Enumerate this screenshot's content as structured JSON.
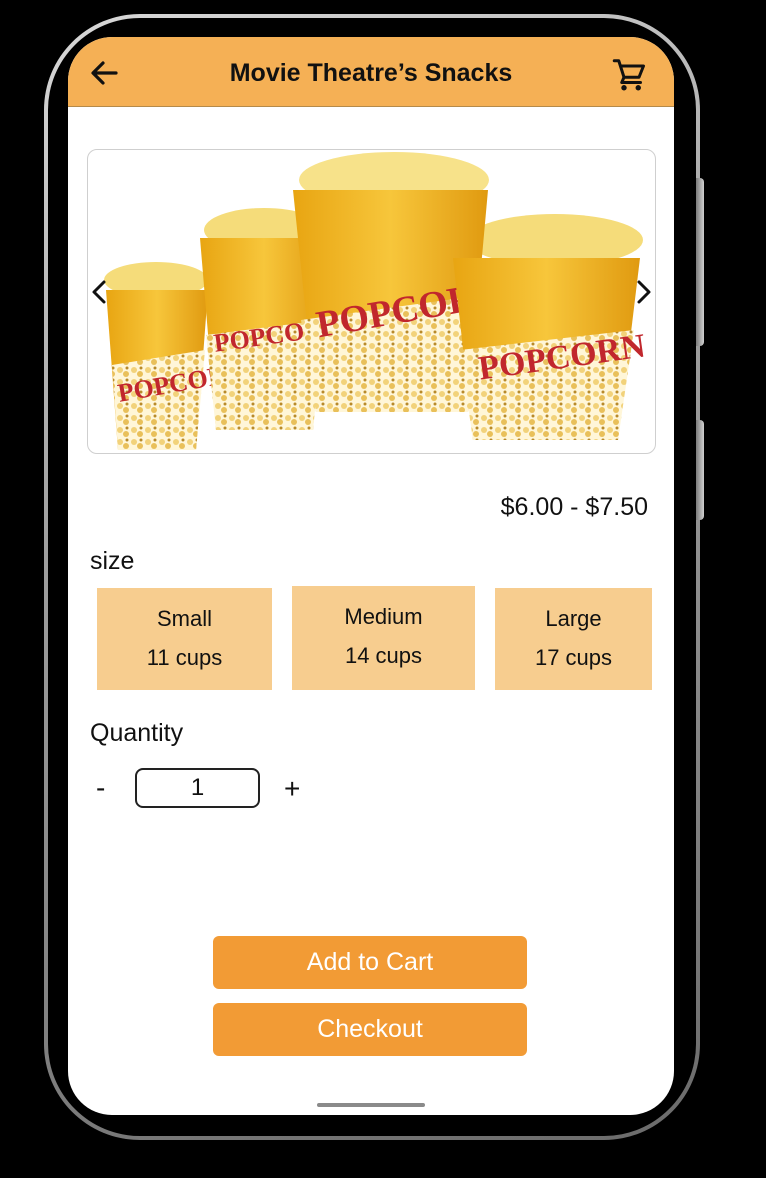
{
  "header": {
    "title": "Movie Theatre’s Snacks",
    "back_icon": "arrow-left-icon",
    "cart_icon": "shopping-cart-icon",
    "background": "#f5b055"
  },
  "product": {
    "image_label": "POPCORN",
    "price_range": "$6.00 - $7.50"
  },
  "size": {
    "label": "size",
    "options": [
      {
        "name": "Small",
        "cups": "11 cups"
      },
      {
        "name": "Medium",
        "cups": "14 cups"
      },
      {
        "name": "Large",
        "cups": "17 cups"
      }
    ],
    "option_color": "#f7cd8f"
  },
  "quantity": {
    "label": "Quantity",
    "minus": "-",
    "value": "1",
    "plus": "+"
  },
  "actions": {
    "add_to_cart": "Add to Cart",
    "checkout": "Checkout",
    "button_color": "#f29b35"
  }
}
